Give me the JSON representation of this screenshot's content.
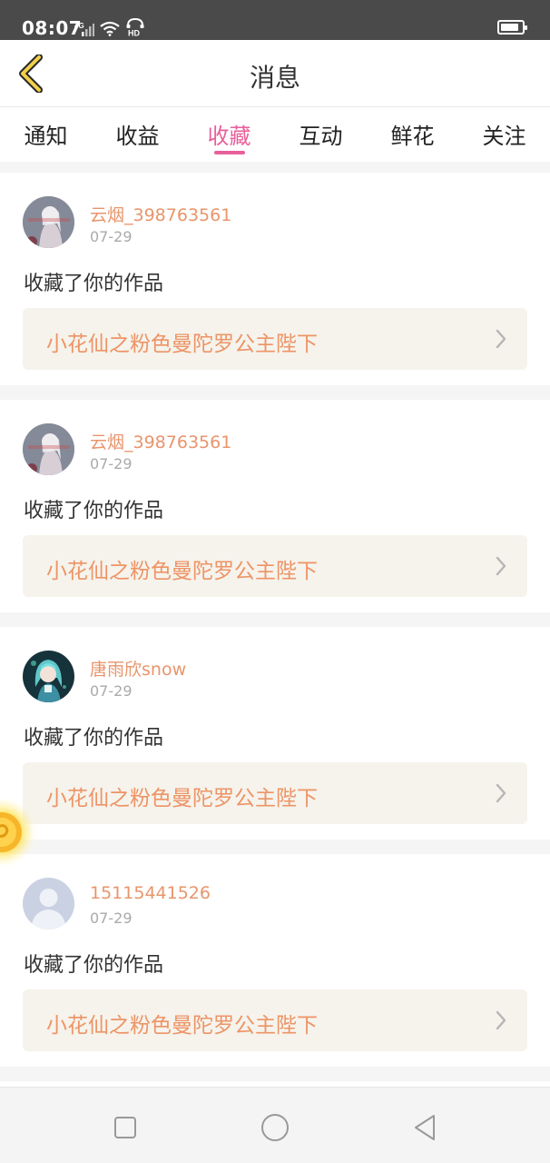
{
  "status_bar": {
    "time": "08:07",
    "network": "4G",
    "hd_label": "HD",
    "battery_level": 0.85,
    "icons": [
      "signal-icon",
      "wifi-icon",
      "hd-call-icon",
      "battery-icon"
    ]
  },
  "header": {
    "title": "消息",
    "back_icon": "chevron-left-icon"
  },
  "tabs": [
    {
      "label": "通知",
      "active": false
    },
    {
      "label": "收益",
      "active": false
    },
    {
      "label": "收藏",
      "active": true
    },
    {
      "label": "互动",
      "active": false
    },
    {
      "label": "鲜花",
      "active": false
    },
    {
      "label": "关注",
      "active": false
    }
  ],
  "colors": {
    "accent": "#e8609a",
    "username": "#e8956b",
    "work_title": "#ee9466",
    "work_bg": "#f5f3ec"
  },
  "messages": [
    {
      "username": "云烟_398763561",
      "date": "07-29",
      "action": "收藏了你的作品",
      "work_title": "小花仙之粉色曼陀罗公主陛下",
      "avatar": "anime-girl-pale-avatar"
    },
    {
      "username": "云烟_398763561",
      "date": "07-29",
      "action": "收藏了你的作品",
      "work_title": "小花仙之粉色曼陀罗公主陛下",
      "avatar": "anime-girl-pale-avatar"
    },
    {
      "username": "唐雨欣snow",
      "date": "07-29",
      "action": "收藏了你的作品",
      "work_title": "小花仙之粉色曼陀罗公主陛下",
      "avatar": "anime-girl-teal-avatar"
    },
    {
      "username": "15115441526",
      "date": "07-29",
      "action": "收藏了你的作品",
      "work_title": "小花仙之粉色曼陀罗公主陛下",
      "avatar": "default-user-avatar"
    }
  ],
  "nav_bar": {
    "buttons": [
      "recent-apps-icon",
      "home-icon",
      "back-triangle-icon"
    ]
  }
}
